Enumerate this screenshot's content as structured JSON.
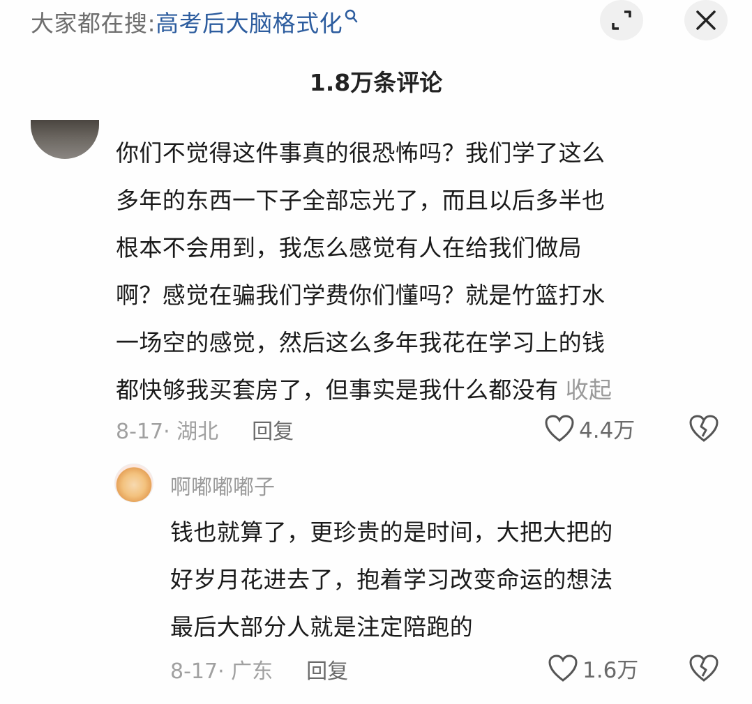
{
  "header": {
    "search_prefix": "大家都在搜:",
    "search_query": "高考后大脑格式化",
    "comment_count": "1.8万条评论"
  },
  "comment": {
    "lines": [
      "你们不觉得这件事真的很恐怖吗？我们学了这么",
      "多年的东西一下子全部忘光了，而且以后多半也",
      "根本不会用到，我怎么感觉有人在给我们做局",
      "啊？感觉在骗我们学费你们懂吗？就是竹篮打水",
      "一场空的感觉，然后这么多年我花在学习上的钱",
      "都快够我买套房了，但事实是我什么都没有"
    ],
    "collapse_label": "收起",
    "date_location": "8-17· 湖北",
    "reply_label": "回复",
    "like_count": "4.4万"
  },
  "reply": {
    "author": "啊嘟嘟嘟子",
    "lines": [
      "钱也就算了，更珍贵的是时间，大把大把的",
      "好岁月花进去了，抱着学习改变命运的想法",
      "最后大部分人就是注定陪跑的"
    ],
    "date_location": "8-17· 广东",
    "reply_label": "回复",
    "like_count": "1.6万"
  },
  "colors": {
    "query_link": "#2c5c9e",
    "muted_text": "#a0a0a0",
    "body_text": "#1a1a1a"
  },
  "icons": [
    "search-icon",
    "expand-icon",
    "close-icon",
    "heart-icon",
    "broken-heart-icon"
  ]
}
